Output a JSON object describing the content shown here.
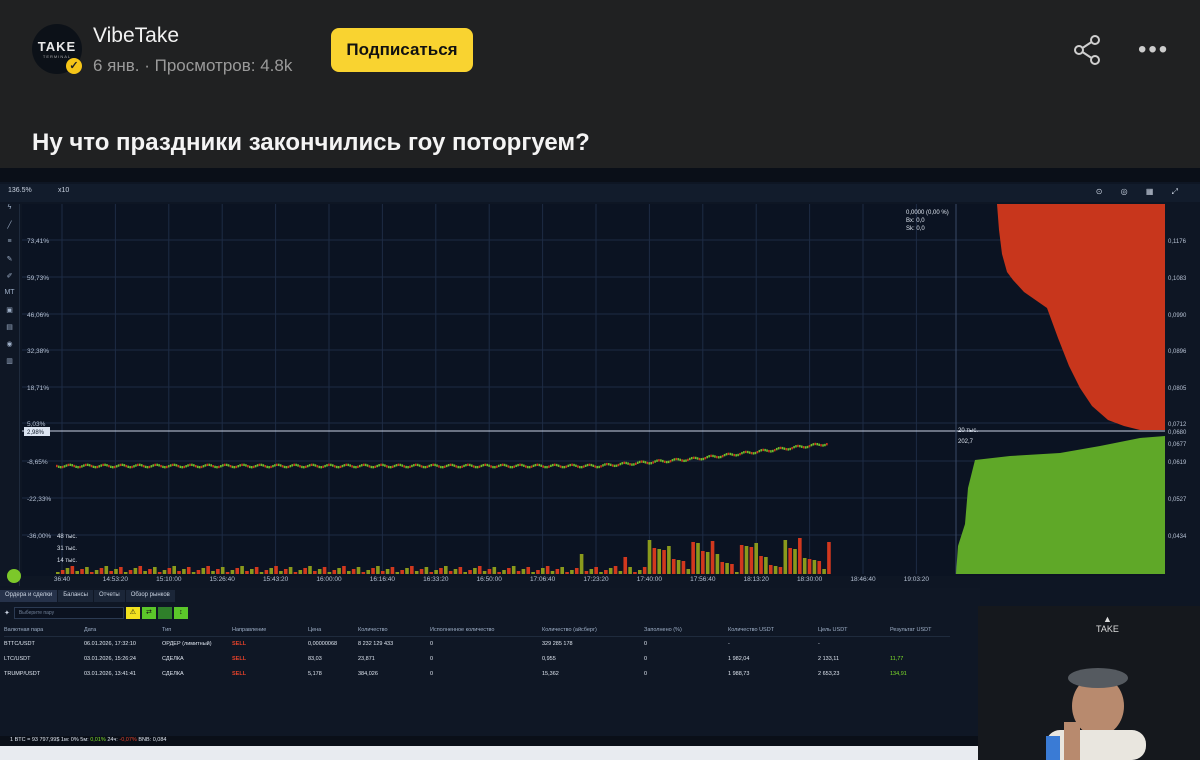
{
  "post": {
    "channel_name": "VibeTake",
    "avatar_text": "TAKE",
    "avatar_subtext": "TERMINAL",
    "meta": "6 янв. · Просмотров: 4.8k",
    "subscribe_label": "Подписаться",
    "title": "Ну что праздники закончились гоу поторгуем?"
  },
  "terminal": {
    "zoom": "136.5%",
    "multiplier": "x10",
    "y_axis_left": [
      "73,41%",
      "59,73%",
      "46,06%",
      "32,38%",
      "18,71%",
      "5,03%",
      "-8,65%",
      "-22,33%",
      "-36,00%"
    ],
    "current_pct": "2,98%",
    "y_axis_right": [
      "0,1176",
      "0,1083",
      "0,0990",
      "0,0896",
      "0,0805",
      "0,0712",
      "0,0680",
      "0,0677",
      "0,0619",
      "0,0527",
      "0,0434"
    ],
    "x_axis": [
      "36:40",
      "14:53:20",
      "15:10:00",
      "15:26:40",
      "15:43:20",
      "16:00:00",
      "16:16:40",
      "16:33:20",
      "16:50:00",
      "17:06:40",
      "17:23:20",
      "17:40:00",
      "17:56:40",
      "18:13:20",
      "18:30:00",
      "18:46:40",
      "19:03:20"
    ],
    "volume_labels": [
      "48 тыс.",
      "31 тыс.",
      "14 тыс."
    ],
    "ob_info": [
      "0,0000 (0,00 %)",
      "Вх: 0,0",
      "Sk: 0,0"
    ],
    "ob_mid": [
      "20 тыс.",
      "202,7"
    ],
    "left_tools": [
      "ϟ",
      "╱",
      "≡",
      "✎",
      "✐",
      "MT",
      "▣",
      "▤",
      "◉",
      "▥"
    ]
  },
  "orders": {
    "tabs": [
      "Ордера и сделки",
      "Балансы",
      "Отчеты",
      "Обзор рынков"
    ],
    "pair_placeholder": "Выберите пару",
    "columns": [
      "Валютная пара",
      "Дата",
      "Тип",
      "Направление",
      "Цена",
      "Количество",
      "Исполненное количество",
      "Количество (айсберг)",
      "Заполнено (%)",
      "Количество USDT",
      "Цель USDT",
      "Результат USDT"
    ],
    "rows": [
      {
        "pair": "BTTC/USDT",
        "date": "06.01.2026, 17:32:10",
        "type": "ОРДЕР (лимитный)",
        "dir": "SELL",
        "price": "0,00000068",
        "qty": "8 232 129 433",
        "filled_qty": "0",
        "iceberg": "329 285 178",
        "filled_pct": "0",
        "usdt": "-",
        "target": "-",
        "result": ""
      },
      {
        "pair": "LTC/USDT",
        "date": "03.01.2026, 15:26:24",
        "type": "СДЕЛКА",
        "dir": "SELL",
        "price": "83,03",
        "qty": "23,871",
        "filled_qty": "0",
        "iceberg": "0,955",
        "filled_pct": "0",
        "usdt": "1 982,04",
        "target": "2 133,11",
        "result": "11,77"
      },
      {
        "pair": "TRUMP/USDT",
        "date": "03.01.2026, 13:41:41",
        "type": "СДЕЛКА",
        "dir": "SELL",
        "price": "5,178",
        "qty": "384,026",
        "filled_qty": "0",
        "iceberg": "15,362",
        "filled_pct": "0",
        "usdt": "1 988,73",
        "target": "2 653,23",
        "result": "134,91"
      }
    ]
  },
  "status_bar": {
    "btc": "1 BTC = 93 797,99$ 1м: 0% 5м:",
    "p5": "0,01%",
    "mid": "24ч:",
    "p24": "-0,07%",
    "bnb": "BNB: 0,084"
  },
  "webcam": {
    "logo_text": "TAKE"
  },
  "colors": {
    "accent": "#f9d330",
    "up": "#6fbf2a",
    "down": "#d2381e"
  }
}
